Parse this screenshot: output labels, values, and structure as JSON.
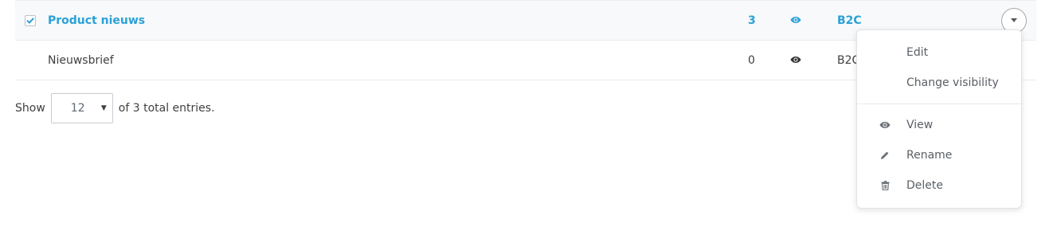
{
  "table": {
    "rows": [
      {
        "name": "Product nieuws",
        "count": "3",
        "type": "B2C",
        "selected": true
      },
      {
        "name": "Nieuwsbrief",
        "count": "0",
        "type": "B2C",
        "selected": false
      }
    ]
  },
  "footer": {
    "show_label": "Show",
    "page_size": "12",
    "total_text": "of 3 total entries."
  },
  "menu": {
    "edit": "Edit",
    "change_visibility": "Change visibility",
    "view": "View",
    "rename": "Rename",
    "delete": "Delete"
  },
  "colors": {
    "accent": "#2aa1d8",
    "text": "#404040",
    "muted": "#595f66"
  }
}
